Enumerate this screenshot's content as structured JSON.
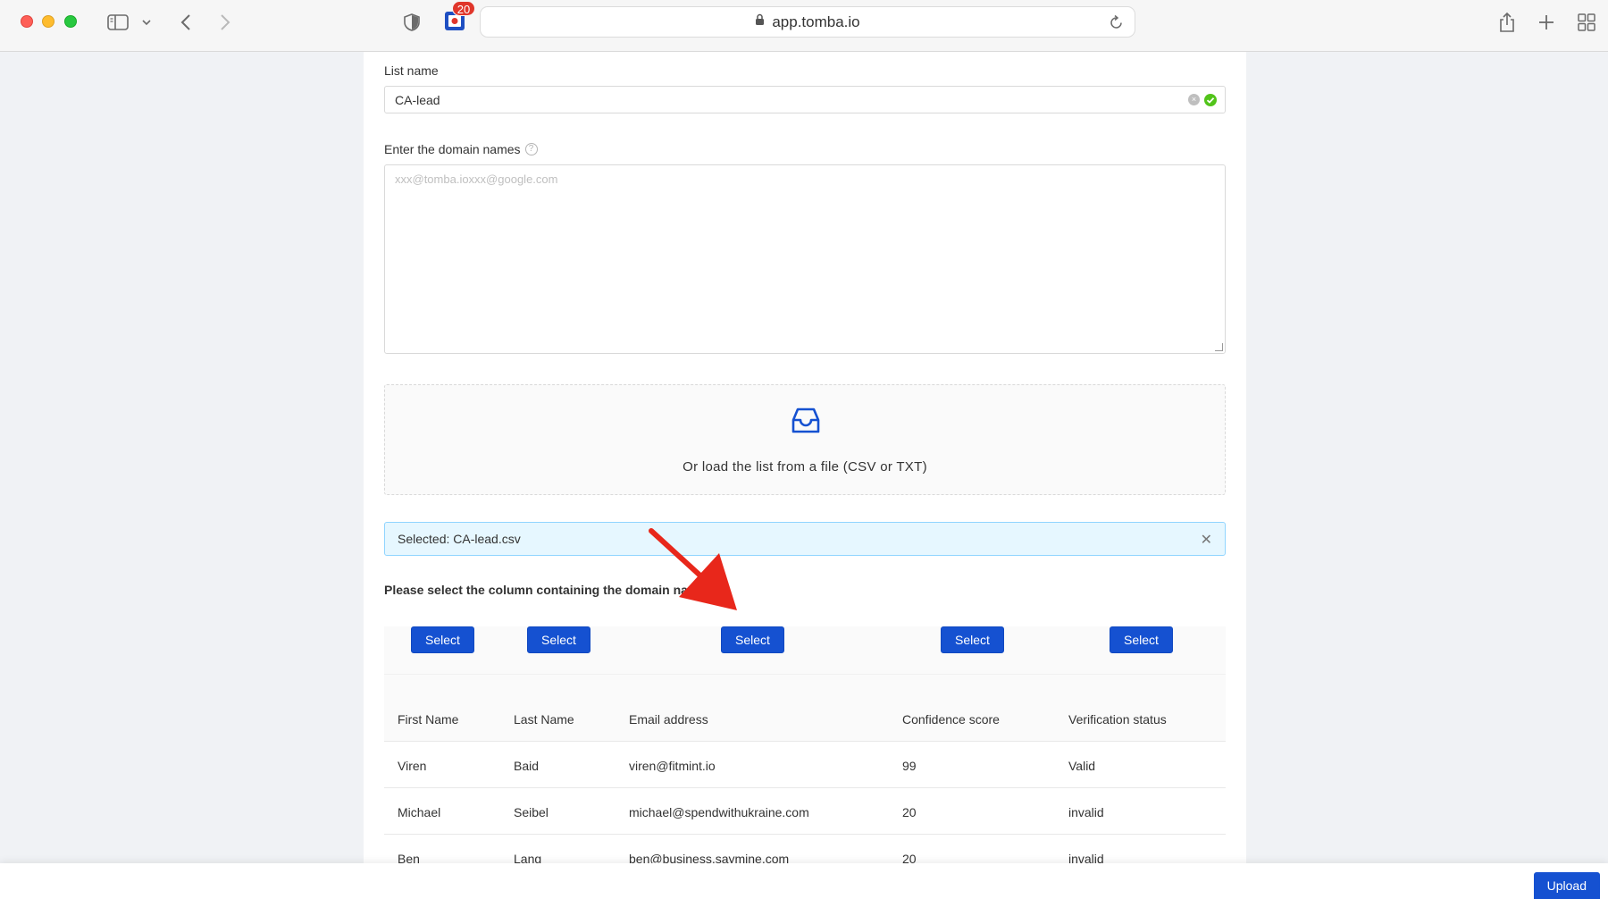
{
  "browser": {
    "url": "app.tomba.io",
    "extension_badge": "20"
  },
  "form": {
    "list_name_label": "List name",
    "list_name_value": "CA-lead",
    "domain_label": "Enter the domain names",
    "domain_help_icon": "?",
    "domain_placeholder": "xxx@tomba.ioxxx@google.com",
    "dropzone_text": "Or load the list from a file (CSV or TXT)",
    "selected_file_text": "Selected: CA-lead.csv",
    "instruction": "Please select the column containing the domain na"
  },
  "table": {
    "select_label": "Select",
    "columns": [
      "First Name",
      "Last Name",
      "Email address",
      "Confidence score",
      "Verification status"
    ],
    "rows": [
      [
        "Viren",
        "Baid",
        "viren@fitmint.io",
        "99",
        "Valid"
      ],
      [
        "Michael",
        "Seibel",
        "michael@spendwithukraine.com",
        "20",
        "invalid"
      ],
      [
        "Ben",
        "Lang",
        "ben@business.saymine.com",
        "20",
        "invalid"
      ]
    ]
  },
  "footer": {
    "upload_label": "Upload"
  },
  "colors": {
    "primary": "#1551d1",
    "arrow": "#e8271b",
    "alert_bg": "#e6f7ff",
    "success": "#52c41a"
  }
}
